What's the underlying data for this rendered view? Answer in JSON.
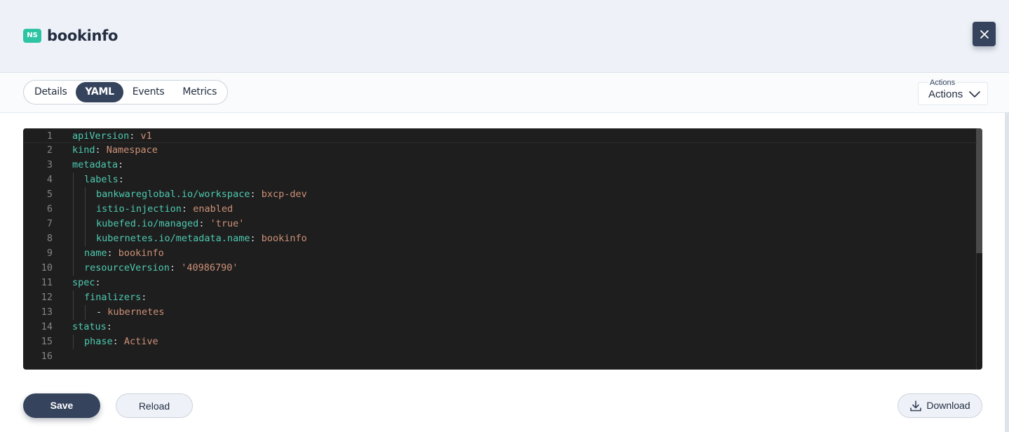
{
  "header": {
    "badge": "NS",
    "title": "bookinfo",
    "close_icon": "close-icon"
  },
  "tabs": [
    {
      "label": "Details",
      "active": false
    },
    {
      "label": "YAML",
      "active": true
    },
    {
      "label": "Events",
      "active": false
    },
    {
      "label": "Metrics",
      "active": false
    }
  ],
  "actions": {
    "small_label": "Actions",
    "label": "Actions",
    "icon": "chevron-down-icon"
  },
  "editor": {
    "lines": [
      {
        "n": "1",
        "indent": 0,
        "key": "apiVersion",
        "sep": ": ",
        "value": "v1"
      },
      {
        "n": "2",
        "indent": 0,
        "key": "kind",
        "sep": ": ",
        "value": "Namespace"
      },
      {
        "n": "3",
        "indent": 0,
        "key": "metadata",
        "sep": ":",
        "value": ""
      },
      {
        "n": "4",
        "indent": 1,
        "key": "labels",
        "sep": ":",
        "value": ""
      },
      {
        "n": "5",
        "indent": 2,
        "key": "bankwareglobal.io/workspace",
        "sep": ": ",
        "value": "bxcp-dev"
      },
      {
        "n": "6",
        "indent": 2,
        "key": "istio-injection",
        "sep": ": ",
        "value": "enabled"
      },
      {
        "n": "7",
        "indent": 2,
        "key": "kubefed.io/managed",
        "sep": ": ",
        "value": "'true'"
      },
      {
        "n": "8",
        "indent": 2,
        "key": "kubernetes.io/metadata.name",
        "sep": ": ",
        "value": "bookinfo"
      },
      {
        "n": "9",
        "indent": 1,
        "key": "name",
        "sep": ": ",
        "value": "bookinfo"
      },
      {
        "n": "10",
        "indent": 1,
        "key": "resourceVersion",
        "sep": ": ",
        "value": "'40986790'"
      },
      {
        "n": "11",
        "indent": 0,
        "key": "spec",
        "sep": ":",
        "value": ""
      },
      {
        "n": "12",
        "indent": 1,
        "key": "finalizers",
        "sep": ":",
        "value": ""
      },
      {
        "n": "13",
        "indent": 2,
        "key": "",
        "sep": "- ",
        "value": "kubernetes"
      },
      {
        "n": "14",
        "indent": 0,
        "key": "status",
        "sep": ":",
        "value": ""
      },
      {
        "n": "15",
        "indent": 1,
        "key": "phase",
        "sep": ": ",
        "value": "Active"
      },
      {
        "n": "16",
        "indent": 0,
        "key": "",
        "sep": "",
        "value": ""
      }
    ]
  },
  "footer": {
    "save_label": "Save",
    "reload_label": "Reload",
    "download_label": "Download",
    "download_icon": "download-icon"
  },
  "colors": {
    "primary": "#36435c",
    "badge": "#2dc4a4",
    "yaml_key": "#4ec9b0",
    "yaml_value": "#ce9178",
    "editor_bg": "#1e1e1e"
  }
}
